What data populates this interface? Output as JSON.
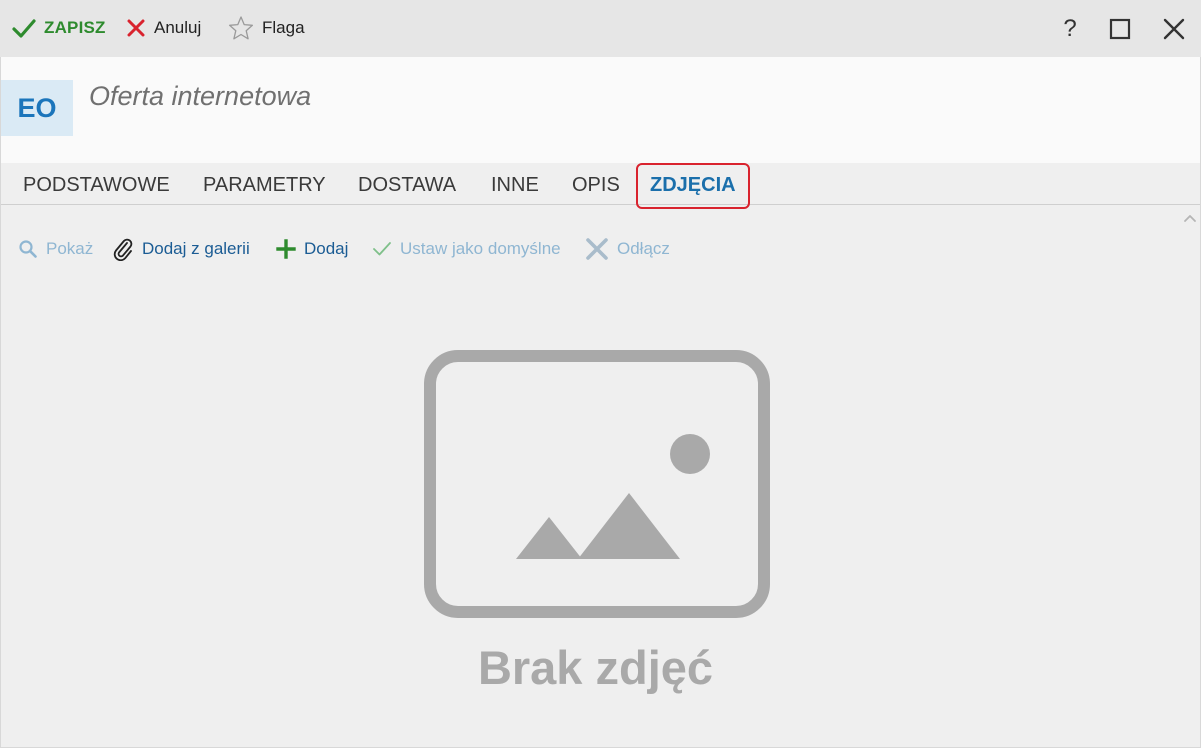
{
  "toolbar": {
    "save_label": "ZAPISZ",
    "cancel_label": "Anuluj",
    "flag_label": "Flaga",
    "help_label": "?"
  },
  "header": {
    "avatar_initials": "EO",
    "title": "Oferta internetowa"
  },
  "tabs": [
    {
      "label": "PODSTAWOWE",
      "active": false
    },
    {
      "label": "PARAMETRY",
      "active": false
    },
    {
      "label": "DOSTAWA",
      "active": false
    },
    {
      "label": "INNE",
      "active": false
    },
    {
      "label": "OPIS",
      "active": false
    },
    {
      "label": "ZDJĘCIA",
      "active": true
    }
  ],
  "actions": [
    {
      "label": "Pokaż",
      "icon": "search-icon",
      "enabled": false
    },
    {
      "label": "Dodaj z galerii",
      "icon": "paperclip-icon",
      "enabled": true
    },
    {
      "label": "Dodaj",
      "icon": "plus-icon",
      "enabled": true
    },
    {
      "label": "Ustaw jako domyślne",
      "icon": "check-icon",
      "enabled": false
    },
    {
      "label": "Odłącz",
      "icon": "close-icon",
      "enabled": false
    }
  ],
  "empty_state": {
    "message": "Brak zdjęć",
    "icon": "image-placeholder-icon"
  },
  "colors": {
    "save_green": "#2e8b2e",
    "cancel_red": "#d9232e",
    "accent_blue": "#1b6fab",
    "tab_highlight": "#d9232e",
    "placeholder_gray": "#a9a9a9"
  }
}
